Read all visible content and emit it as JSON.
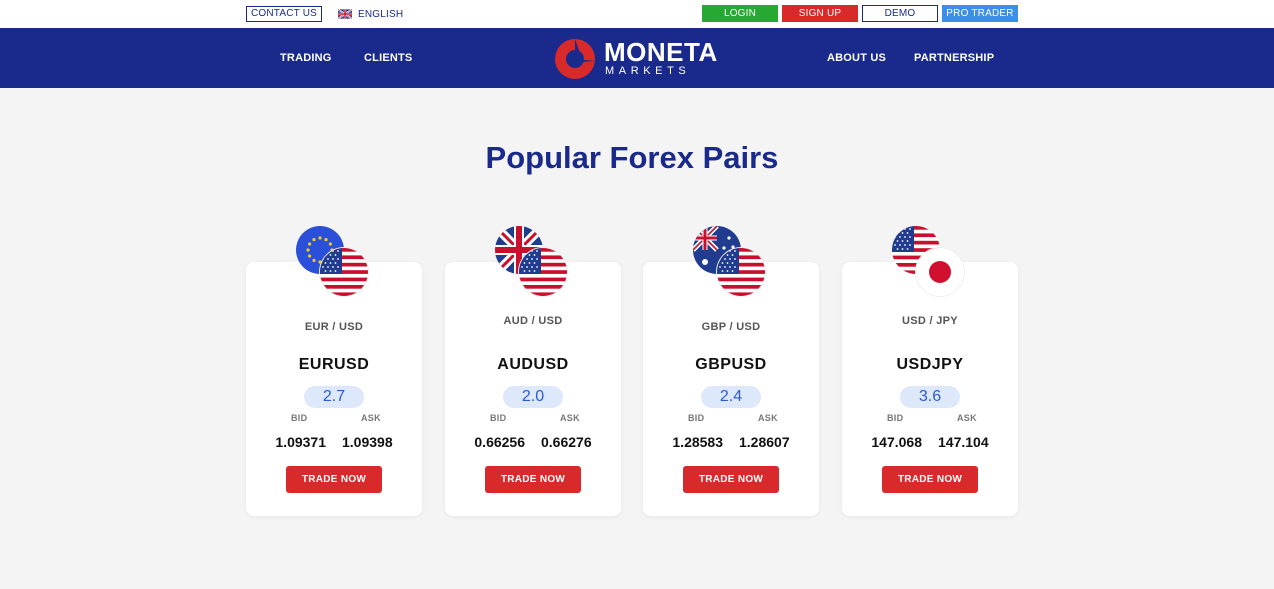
{
  "topbar": {
    "contact_label": "CONTACT US",
    "language_label": "ENGLISH",
    "login_label": "LOGIN",
    "signup_label": "SIGN UP",
    "demo_label": "DEMO",
    "pro_label": "PRO TRADER"
  },
  "nav": {
    "trading": "TRADING",
    "clients": "CLIENTS",
    "about": "ABOUT US",
    "partnership": "PARTNERSHIP",
    "logo_main": "MONETA",
    "logo_sub": "MARKETS"
  },
  "main": {
    "heading": "Popular Forex Pairs",
    "bid_label": "BID",
    "ask_label": "ASK",
    "cards": [
      {
        "pair": "EUR / USD",
        "symbol": "EURUSD",
        "spread": "2.7",
        "bid": "1.09371",
        "ask": "1.09398",
        "cta": "TRADE NOW",
        "flag_base": "eu-flag-icon",
        "flag_quote": "us-flag-icon"
      },
      {
        "pair": "AUD / USD",
        "symbol": "AUDUSD",
        "spread": "2.0",
        "bid": "0.66256",
        "ask": "0.66276",
        "cta": "TRADE NOW",
        "flag_base": "uk-flag-icon",
        "flag_quote": "us-flag-icon"
      },
      {
        "pair": "GBP / USD",
        "symbol": "GBPUSD",
        "spread": "2.4",
        "bid": "1.28583",
        "ask": "1.28607",
        "cta": "TRADE NOW",
        "flag_base": "au-flag-icon",
        "flag_quote": "us-flag-icon"
      },
      {
        "pair": "USD / JPY",
        "symbol": "USDJPY",
        "spread": "3.6",
        "bid": "147.068",
        "ask": "147.104",
        "cta": "TRADE NOW",
        "flag_base": "us-flag-icon",
        "flag_quote": "jp-flag-icon"
      }
    ]
  },
  "colors": {
    "brand_navy": "#1a2a8c",
    "brand_red": "#d82a2a",
    "login_green": "#27a833",
    "pro_blue": "#3b8fe8",
    "spread_bg": "#dde8fb",
    "page_bg": "#f4f4f4"
  }
}
